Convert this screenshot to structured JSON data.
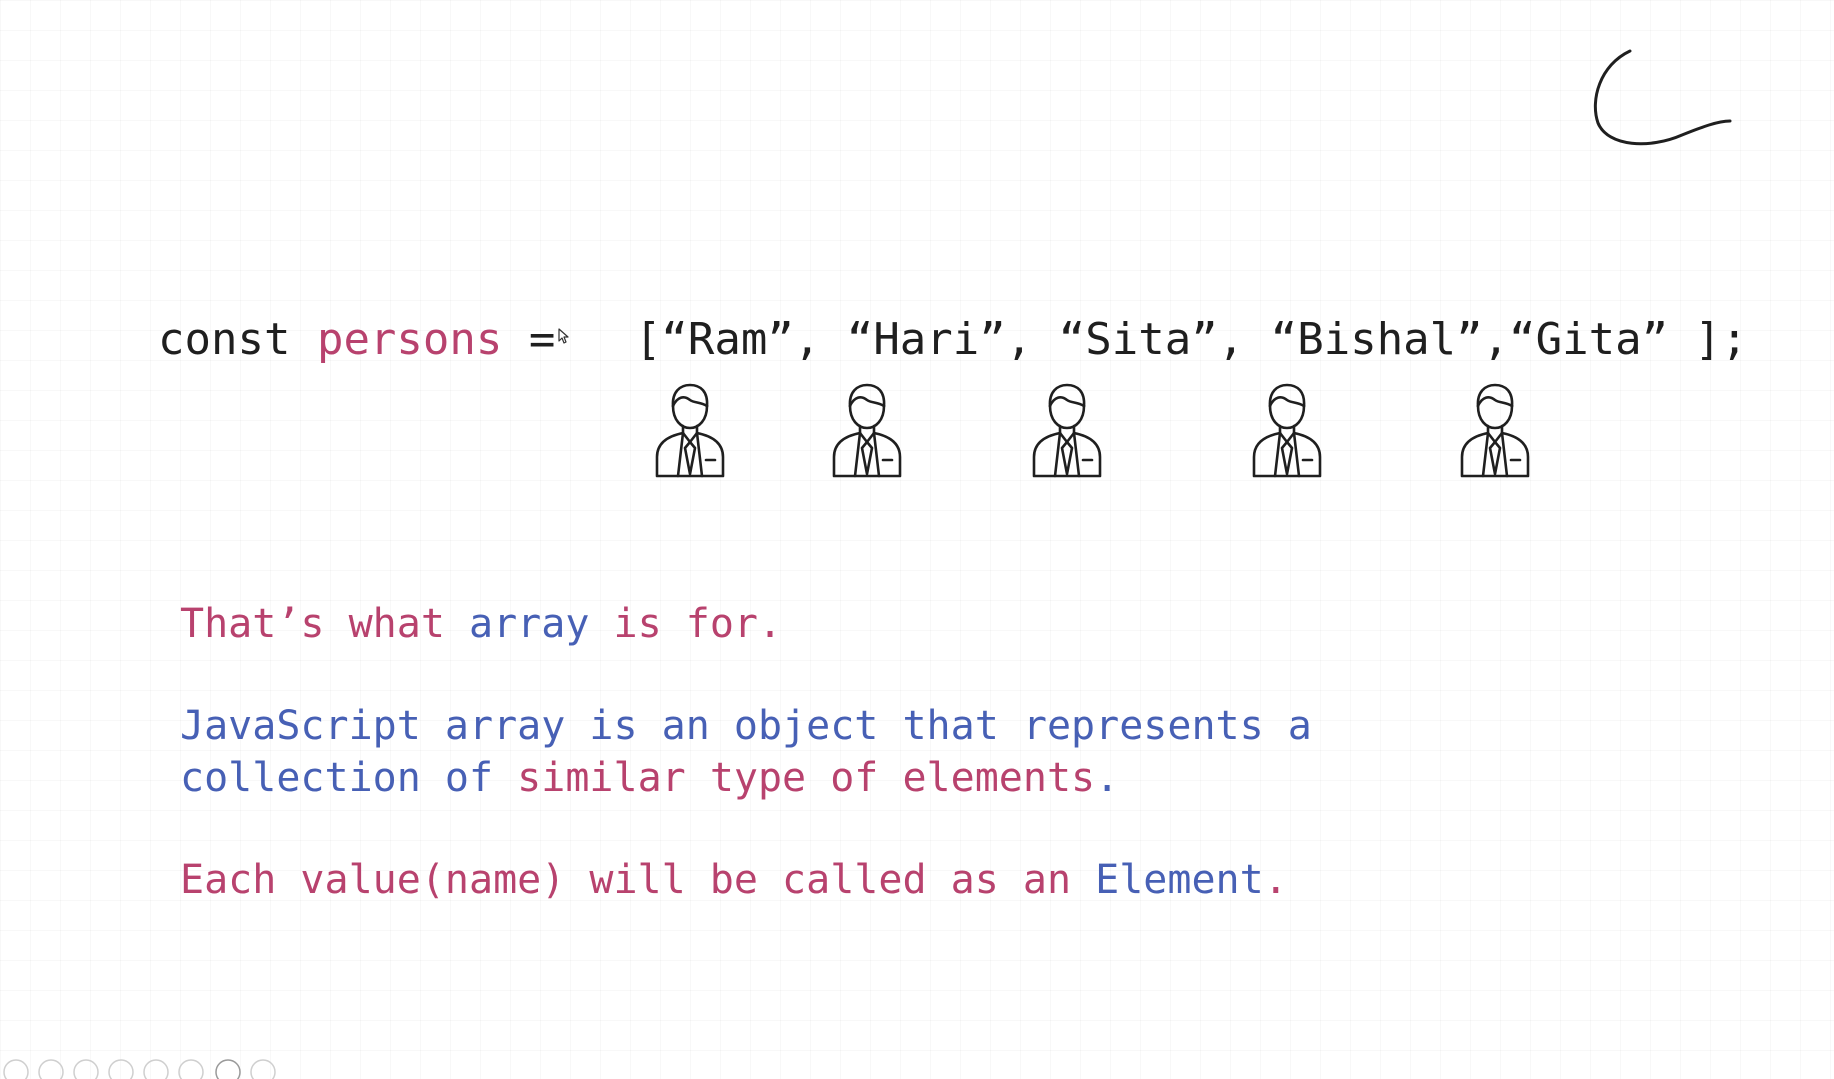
{
  "code": {
    "keyword": "const",
    "variable": "persons",
    "operator": "=",
    "open_bracket": "[",
    "close": " ];",
    "names": [
      "“Ram”",
      "“Hari”",
      "“Sita”",
      "“Bishal”",
      "“Gita”"
    ],
    "separator": ","
  },
  "icons": {
    "person_icon": "businessman-icon",
    "count": 5
  },
  "text": {
    "line1": {
      "part1": "That’s what ",
      "highlight": "array",
      "part2": " is for."
    },
    "line2": {
      "row1": "JavaScript array is an object that represents a",
      "row2_part1": "collection of ",
      "row2_highlight": "similar type of elements",
      "row2_part2": "."
    },
    "line3": {
      "part1": "Each value(name) will be called as an ",
      "highlight": "Element",
      "part2": "."
    }
  },
  "colors": {
    "pink": "#b8426e",
    "blue": "#4760b5",
    "ink": "#1f1f1f"
  }
}
